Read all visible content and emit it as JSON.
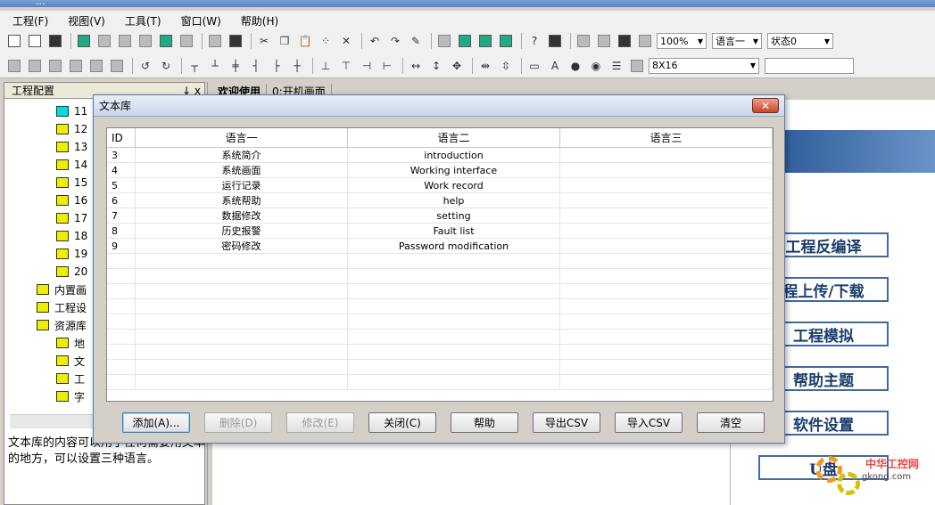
{
  "window": {
    "title": "..."
  },
  "menu": [
    "工程(F)",
    "视图(V)",
    "工具(T)",
    "窗口(W)",
    "帮助(H)"
  ],
  "toolbar": {
    "zoom": "100%",
    "language": "语言一",
    "state": "状态0",
    "font_size": "8X16"
  },
  "left_panel": {
    "header": "工程配置",
    "pin": "↓ x",
    "tree": [
      {
        "label": "11",
        "indent": 58,
        "icon": "screen-cyan"
      },
      {
        "label": "12",
        "indent": 58,
        "icon": "screen"
      },
      {
        "label": "13",
        "indent": 58,
        "icon": "screen"
      },
      {
        "label": "14",
        "indent": 58,
        "icon": "screen"
      },
      {
        "label": "15",
        "indent": 58,
        "icon": "screen"
      },
      {
        "label": "16",
        "indent": 58,
        "icon": "screen"
      },
      {
        "label": "17",
        "indent": 58,
        "icon": "screen"
      },
      {
        "label": "18",
        "indent": 58,
        "icon": "screen"
      },
      {
        "label": "19",
        "indent": 58,
        "icon": "screen"
      },
      {
        "label": "20",
        "indent": 58,
        "icon": "screen"
      },
      {
        "label": "内置画",
        "indent": 36,
        "icon": "folder"
      },
      {
        "label": "工程设",
        "indent": 36,
        "icon": "folder"
      },
      {
        "label": "资源库",
        "indent": 36,
        "icon": "folder"
      },
      {
        "label": "地",
        "indent": 58,
        "icon": "plc"
      },
      {
        "label": "文",
        "indent": 58,
        "icon": "doc"
      },
      {
        "label": "工",
        "indent": 58,
        "icon": "tool"
      },
      {
        "label": "字",
        "indent": 58,
        "icon": "font"
      }
    ],
    "description": "文本库的内容可以用于任何需要用文本的地方，可以设置三种语言。"
  },
  "tabs": [
    "欢迎使用",
    "0:开机画面"
  ],
  "right_buttons": [
    "工程反编译",
    "程上传/下载",
    "工程模拟",
    "帮助主题",
    "软件设置",
    "U盘"
  ],
  "logo": {
    "line1": "中华工控网",
    "line2": "gkong.com"
  },
  "dialog": {
    "title": "文本库",
    "close": "✕",
    "columns": [
      "ID",
      "语言一",
      "语言二",
      "语言三"
    ],
    "rows": [
      {
        "id": "3",
        "l1": "系统简介",
        "l2": "introduction",
        "l3": ""
      },
      {
        "id": "4",
        "l1": "系统画面",
        "l2": "Working interface",
        "l3": ""
      },
      {
        "id": "5",
        "l1": "运行记录",
        "l2": "Work record",
        "l3": ""
      },
      {
        "id": "6",
        "l1": "系统帮助",
        "l2": "help",
        "l3": ""
      },
      {
        "id": "7",
        "l1": "数据修改",
        "l2": "setting",
        "l3": ""
      },
      {
        "id": "8",
        "l1": "历史报警",
        "l2": "Fault list",
        "l3": ""
      },
      {
        "id": "9",
        "l1": "密码修改",
        "l2": "Password modification",
        "l3": ""
      }
    ],
    "buttons": {
      "add": "添加(A)...",
      "delete": "删除(D)",
      "modify": "修改(E)",
      "close": "关闭(C)",
      "help": "帮助",
      "export_csv": "导出CSV",
      "import_csv": "导入CSV",
      "clear": "清空"
    }
  }
}
